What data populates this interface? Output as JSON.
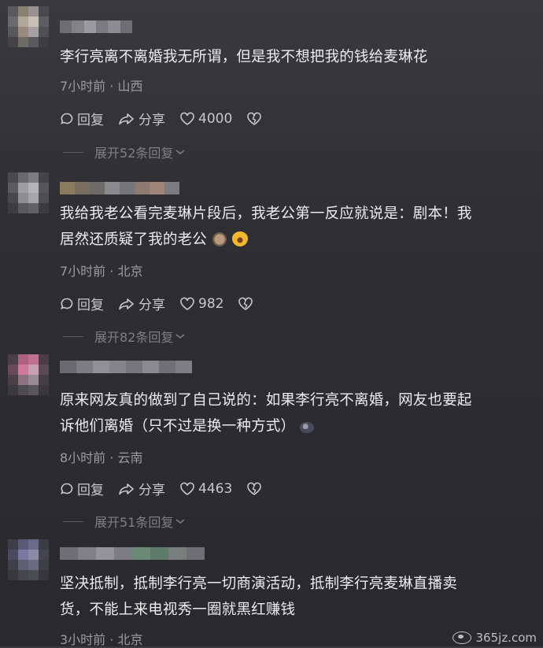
{
  "comments": [
    {
      "text": "李行亮离不离婚我无所谓，但是我不想把我的钱给麦琳花",
      "meta": "7小时前 · 山西",
      "reply_label": "回复",
      "share_label": "分享",
      "likes": "4000",
      "expand_label": "展开52条回复"
    },
    {
      "text_line1": "我给我老公看完麦琳片段后，我老公第一反应就说是：剧本！我",
      "text_line2": "居然还质疑了我的老公",
      "meta": "7小时前 · 北京",
      "reply_label": "回复",
      "share_label": "分享",
      "likes": "982",
      "expand_label": "展开82条回复"
    },
    {
      "text_line1": "原来网友真的做到了自己说的：如果李行亮不离婚，网友也要起",
      "text_line2": "诉他们离婚（只不过是换一种方式）",
      "meta": "8小时前 · 云南",
      "reply_label": "回复",
      "share_label": "分享",
      "likes": "4463",
      "expand_label": "展开51条回复"
    },
    {
      "text_line1": "坚决抵制，抵制李行亮一切商演活动，抵制李行亮麦琳直播卖",
      "text_line2": "货，不能上来电视秀一圈就黑红赚钱",
      "meta": "3小时前 · 北京"
    }
  ],
  "watermark": "365jz.com",
  "icons": {
    "reply": "comment-bubble-icon",
    "share": "share-arrow-icon",
    "like": "heart-icon",
    "dislike": "broken-heart-icon"
  },
  "colors": {
    "background": "#2f2f33",
    "text": "#ececef",
    "meta": "#9b9ba0",
    "expand": "#7e7e84"
  }
}
